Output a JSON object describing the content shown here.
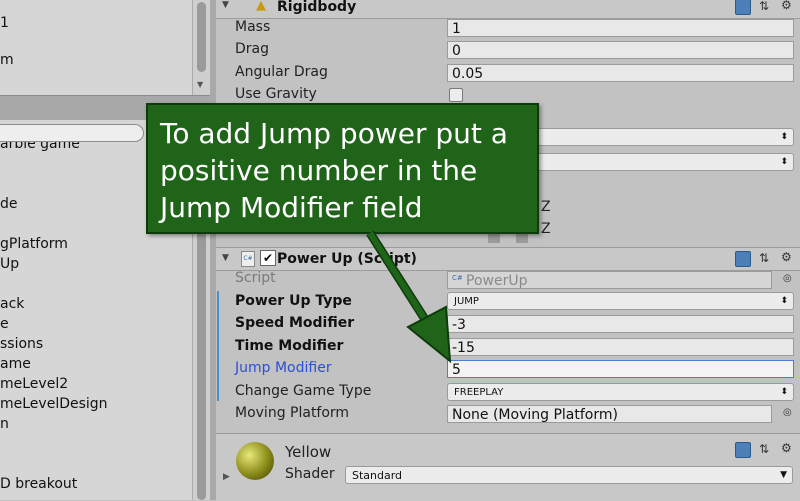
{
  "hierarchy_top": {
    "items": [
      "1",
      "m"
    ]
  },
  "project": {
    "items": [
      "arble game",
      "de",
      "gPlatform",
      "Up",
      "ack",
      "e",
      "ssions",
      "ame",
      "meLevel2",
      "meLevelDesign",
      "n",
      "D breakout"
    ]
  },
  "rigidbody": {
    "title": "Rigidbody",
    "mass_label": "Mass",
    "mass_value": "1",
    "drag_label": "Drag",
    "drag_value": "0",
    "angular_drag_label": "Angular Drag",
    "angular_drag_value": "0.05",
    "use_gravity_label": "Use Gravity",
    "z1": "Z",
    "z2": "Z"
  },
  "powerup": {
    "title": "Power Up (Script)",
    "script_label": "Script",
    "script_value": "PowerUp",
    "type_label": "Power Up Type",
    "type_value": "JUMP",
    "speed_label": "Speed Modifier",
    "speed_value": "-3",
    "time_label": "Time Modifier",
    "time_value": "-15",
    "jump_label": "Jump Modifier",
    "jump_value": "5",
    "game_type_label": "Change Game Type",
    "game_type_value": "FREEPLAY",
    "moving_label": "Moving Platform",
    "moving_value": "None (Moving Platform)"
  },
  "material": {
    "name": "Yellow",
    "shader_label": "Shader",
    "shader_value": "Standard"
  },
  "callout": {
    "text": "To add Jump power put a positive number in the Jump Modifier field"
  },
  "colors": {
    "callout_bg": "#1f6418",
    "active_label": "#2b4fd6",
    "selection_mark": "#4a90c8"
  }
}
